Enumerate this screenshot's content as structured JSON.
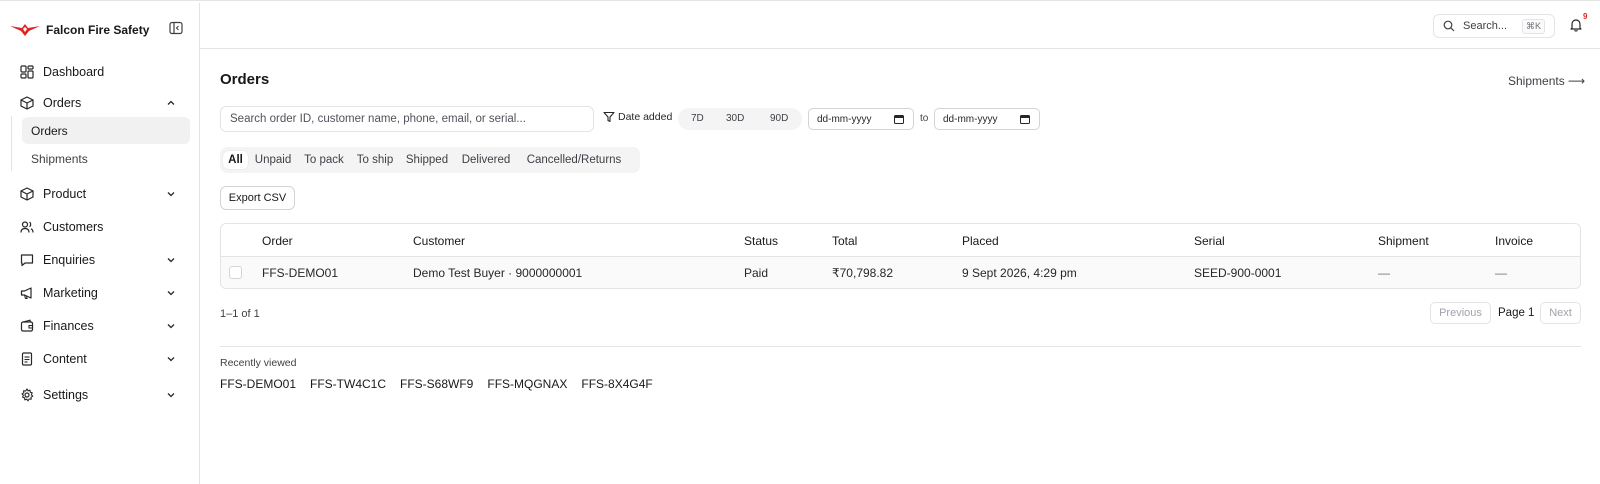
{
  "app": {
    "brand_name": "Falcon Fire Safety",
    "accent_color": "#dc2626"
  },
  "sidebar": {
    "items": [
      {
        "label": "Dashboard",
        "icon": "dashboard-icon"
      },
      {
        "label": "Orders",
        "icon": "box-icon",
        "expanded": true
      },
      {
        "label": "Product",
        "icon": "box-icon"
      },
      {
        "label": "Customers",
        "icon": "users-icon"
      },
      {
        "label": "Enquiries",
        "icon": "message-icon"
      },
      {
        "label": "Marketing",
        "icon": "megaphone-icon"
      },
      {
        "label": "Finances",
        "icon": "wallet-icon"
      },
      {
        "label": "Content",
        "icon": "document-icon"
      },
      {
        "label": "Settings",
        "icon": "gear-icon"
      }
    ],
    "orders_sub": [
      "Orders",
      "Shipments"
    ]
  },
  "header": {
    "search_label": "Search...",
    "search_shortcut": "⌘K",
    "notification_count": "9"
  },
  "main": {
    "title": "Orders",
    "shipments_link": "Shipments ⟶",
    "search_placeholder": "Search order ID, customer name, phone, email, or serial...",
    "date_filter_label": "Date added",
    "ranges": [
      "7D",
      "30D",
      "90D"
    ],
    "date_from_placeholder": "dd-mm-yyyy",
    "date_to_placeholder": "dd-mm-yyyy",
    "to_label": "to",
    "status_tabs": [
      "All",
      "Unpaid",
      "To pack",
      "To ship",
      "Shipped",
      "Delivered",
      "Cancelled/Returns"
    ],
    "active_tab": "All",
    "export_label": "Export CSV"
  },
  "table": {
    "columns": [
      "Order",
      "Customer",
      "Status",
      "Total",
      "Placed",
      "Serial",
      "Shipment",
      "Invoice"
    ],
    "rows": [
      {
        "order": "FFS-DEMO01",
        "customer": "Demo Test Buyer · 9000000001",
        "status": "Paid",
        "total": "₹70,798.82",
        "placed": "9 Sept 2026, 4:29 pm",
        "serial": "SEED-900-0001",
        "shipment": "—",
        "invoice": "—"
      }
    ]
  },
  "pagination": {
    "count_text": "1–1 of 1",
    "previous": "Previous",
    "page_label": "Page 1",
    "next": "Next"
  },
  "recently_viewed": {
    "title": "Recently viewed",
    "items": [
      "FFS-DEMO01",
      "FFS-TW4C1C",
      "FFS-S68WF9",
      "FFS-MQGNAX",
      "FFS-8X4G4F"
    ]
  }
}
